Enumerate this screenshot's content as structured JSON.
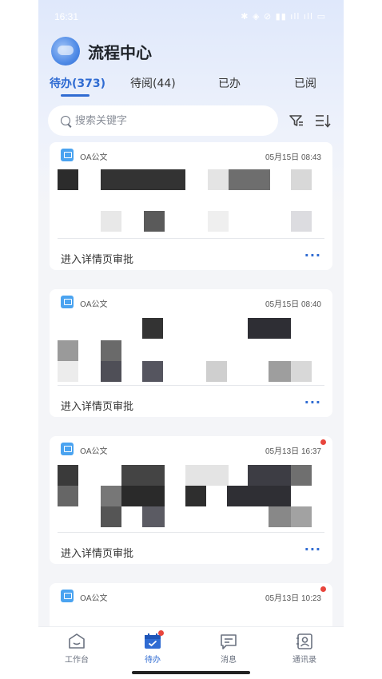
{
  "status_bar": {
    "time": "16:31",
    "indicators": "✱ ◈ ⊘ ▮▮ ıll ıll ▭"
  },
  "header": {
    "title": "流程中心"
  },
  "tabs": [
    {
      "label": "待办(373)",
      "active": true
    },
    {
      "label": "待阅(44)",
      "active": false
    },
    {
      "label": "已办",
      "active": false
    },
    {
      "label": "已阅",
      "active": false
    }
  ],
  "search": {
    "placeholder": "搜索关键字",
    "value": ""
  },
  "cards": [
    {
      "app": "OA公文",
      "time": "05月15日 08:43",
      "unread": false,
      "action": "进入详情页审批",
      "more": "···"
    },
    {
      "app": "OA公文",
      "time": "05月15日 08:40",
      "unread": false,
      "action": "进入详情页审批",
      "more": "···"
    },
    {
      "app": "OA公文",
      "time": "05月13日 16:37",
      "unread": true,
      "action": "进入详情页审批",
      "more": "···"
    },
    {
      "app": "OA公文",
      "time": "05月13日 10:23",
      "unread": true
    }
  ],
  "bottom_nav": [
    {
      "label": "工作台",
      "icon": "workbench-icon",
      "active": false
    },
    {
      "label": "待办",
      "icon": "todo-calendar-icon",
      "active": true,
      "badge": true
    },
    {
      "label": "消息",
      "icon": "message-icon",
      "active": false
    },
    {
      "label": "通讯录",
      "icon": "contacts-icon",
      "active": false
    }
  ],
  "colors": {
    "accent": "#2f6bd2",
    "badge": "#e8453c",
    "app_icon": "#4aa3f0"
  }
}
